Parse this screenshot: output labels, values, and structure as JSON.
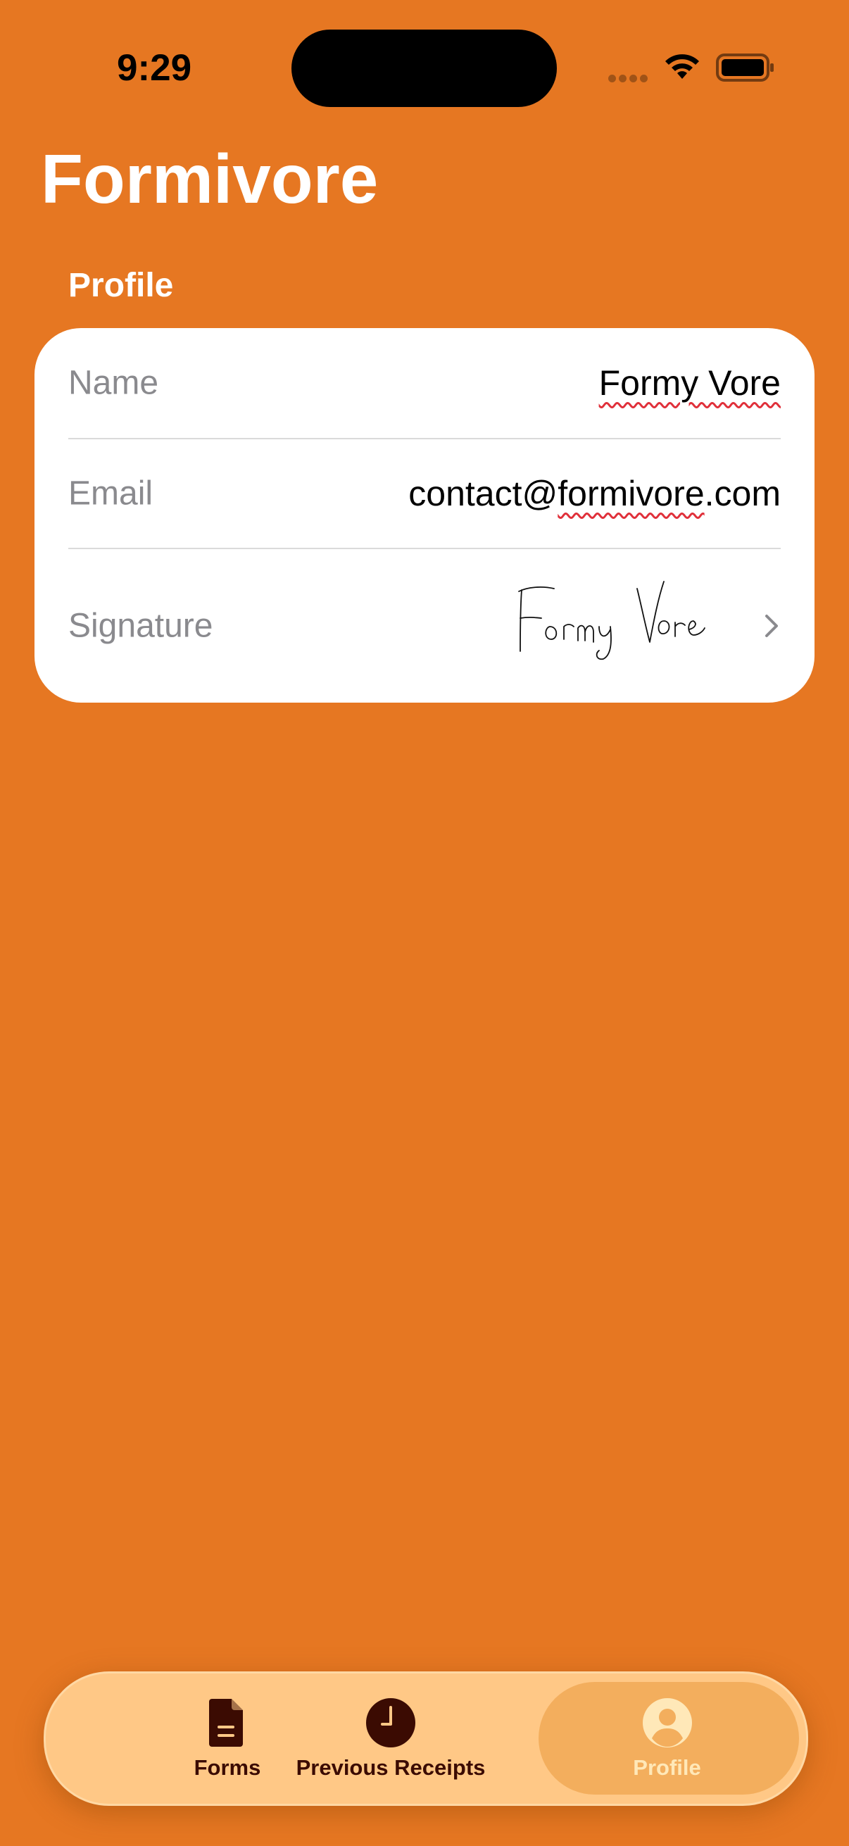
{
  "status_bar": {
    "time": "9:29"
  },
  "header": {
    "app_title": "Formivore"
  },
  "profile_section": {
    "header": "Profile",
    "rows": {
      "name": {
        "label": "Name",
        "value": "Formy Vore"
      },
      "email": {
        "label": "Email",
        "value": "contact@formivore.com"
      },
      "signature": {
        "label": "Signature",
        "value": "Formy Vore"
      }
    }
  },
  "tab_bar": {
    "tabs": [
      {
        "label": "Forms",
        "icon": "document-icon",
        "selected": false
      },
      {
        "label": "Previous Receipts",
        "icon": "clock-icon",
        "selected": false
      },
      {
        "label": "Profile",
        "icon": "person-circle-icon",
        "selected": true
      }
    ]
  },
  "colors": {
    "background": "#E67722",
    "card": "#FFFFFF",
    "tab_bar": "#FFC886",
    "tab_selected": "#F3AE5D",
    "tab_icon": "#3B0B02",
    "spellcheck": "#E0303A"
  }
}
